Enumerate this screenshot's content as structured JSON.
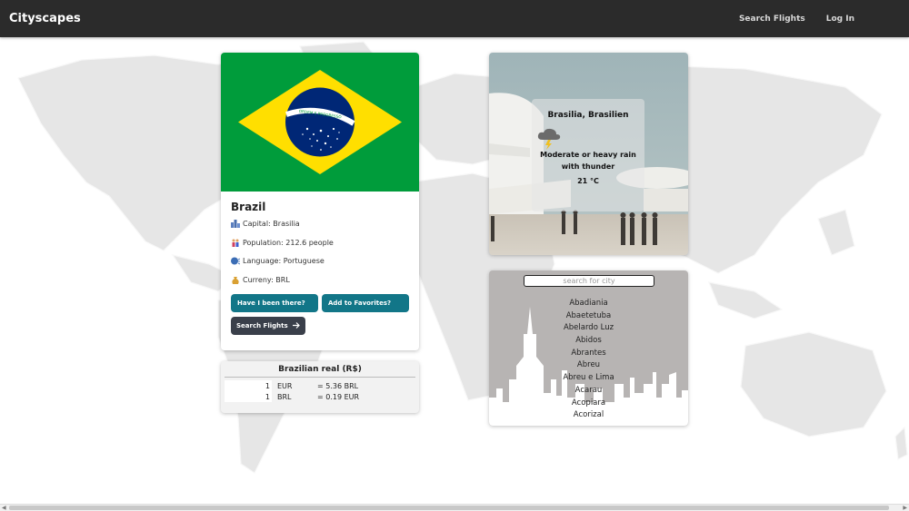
{
  "navbar": {
    "brand": "Cityscapes",
    "links": [
      "Search Flights",
      "Log In"
    ]
  },
  "country": {
    "name": "Brazil",
    "flag_banner_text": "ORDEM E PROGRESSO",
    "capital": "Capital: Brasilia",
    "population": "Population: 212.6 people",
    "language": "Language: Portuguese",
    "currency": "Curreny: BRL",
    "icons": {
      "capital": "cityscape-icon",
      "population": "people-icon",
      "language": "speaking-head-icon",
      "currency": "money-bag-icon"
    },
    "buttons": {
      "been_there": "Have I been there?",
      "favorites": "Add to Favorites?",
      "search_flights": "Search Flights"
    }
  },
  "currency_card": {
    "title": "Brazilian real (R$)",
    "rows": [
      {
        "amount": "1",
        "code": "EUR",
        "result": "= 5.36 BRL"
      },
      {
        "amount": "1",
        "code": "BRL",
        "result": "= 0.19 EUR"
      }
    ]
  },
  "weather": {
    "city": "Brasilia, Brasilien",
    "description": "Moderate or heavy rain with thunder",
    "temperature": "21 °C",
    "icon": "thunderstorm-icon"
  },
  "cities": {
    "placeholder": "search for city",
    "items": [
      "Abadiania",
      "Abaetetuba",
      "Abelardo Luz",
      "Abidos",
      "Abrantes",
      "Abreu",
      "Abreu e Lima",
      "Acarau",
      "Acopiara",
      "Acorizal"
    ]
  },
  "colors": {
    "navbar": "#2b2b2b",
    "button_teal": "#127688",
    "button_dark": "#3a3f4a",
    "flag_green": "#009c3b",
    "flag_yellow": "#ffdf00",
    "flag_blue": "#002776"
  }
}
